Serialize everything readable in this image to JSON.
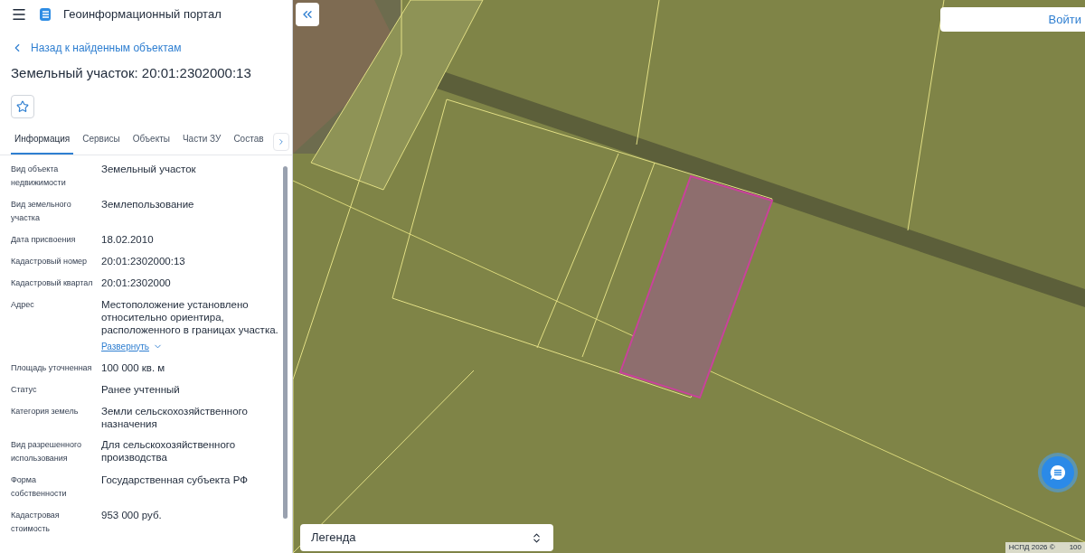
{
  "header": {
    "title": "Геоинформационный портал"
  },
  "back_link": "Назад к найденным объектам",
  "object_title": "Земельный участок: 20:01:2302000:13",
  "favorite": {
    "selected": false
  },
  "tabs": [
    {
      "label": "Информация",
      "selected": true
    },
    {
      "label": "Сервисы",
      "selected": false
    },
    {
      "label": "Объекты",
      "selected": false
    },
    {
      "label": "Части ЗУ",
      "selected": false
    },
    {
      "label": "Состав",
      "selected": false
    }
  ],
  "properties": [
    {
      "label": "Вид объекта недвижимости",
      "value": "Земельный участок"
    },
    {
      "label": "Вид земельного участка",
      "value": "Землепользование"
    },
    {
      "label": "Дата присвоения",
      "value": "18.02.2010"
    },
    {
      "label": "Кадастровый номер",
      "value": "20:01:2302000:13"
    },
    {
      "label": "Кадастровый квартал",
      "value": "20:01:2302000"
    },
    {
      "label": "Адрес",
      "value": "Местоположение установлено относительно ориентира, расположенного в границах участка.",
      "expand_link": "Развернуть"
    },
    {
      "label": "Площадь уточненная",
      "value": "100 000 кв. м"
    },
    {
      "label": "Статус",
      "value": "Ранее учтенный"
    },
    {
      "label": "Категория земель",
      "value": "Земли сельскохозяйственного назначения"
    },
    {
      "label": "Вид разрешенного использования",
      "value": "Для сельскохозяйственного производства"
    },
    {
      "label": "Форма собственности",
      "value": "Государственная субъекта РФ"
    },
    {
      "label": "Кадастровая стоимость",
      "value": "953 000 руб."
    }
  ],
  "map": {
    "login_button": "Войти",
    "legend": "Легенда",
    "attribution": "НСПД 2026 ©",
    "scale": "100"
  }
}
